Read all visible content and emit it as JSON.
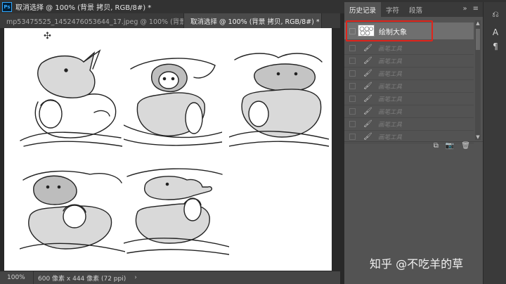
{
  "window": {
    "title": "取消选择 @ 100% (背景 拷贝, RGB/8#) *",
    "logo_text": "Ps",
    "minimize": "—",
    "restore": "❐",
    "close": "✕"
  },
  "doc_tabs": [
    {
      "label": "mp53475525_1452476053644_17.jpeg @ 100% (背景...",
      "close": "×",
      "active": false
    },
    {
      "label": "取消选择 @ 100% (背景 拷贝, RGB/8#) *",
      "close": "×",
      "active": true
    }
  ],
  "status": {
    "zoom": "100%",
    "doc_info": "600 像素 x 444 像素 (72 ppi)",
    "arrow": "›"
  },
  "panel": {
    "tabs": [
      {
        "label": "历史记录",
        "active": true
      },
      {
        "label": "字符",
        "active": false
      },
      {
        "label": "段落",
        "active": false
      }
    ],
    "collapse_icon": "»",
    "menu_icon": "≡",
    "snapshot_label": "绘制大象",
    "history_items": [
      "画笔工具",
      "画笔工具",
      "画笔工具",
      "画笔工具",
      "画笔工具",
      "画笔工具",
      "画笔工具",
      "画笔工具"
    ]
  },
  "watermark": "知乎 @不吃羊的草",
  "colors": {
    "highlight_box": "#e0241b",
    "panel_bg": "#535353",
    "canvas_bg": "#ffffff"
  }
}
